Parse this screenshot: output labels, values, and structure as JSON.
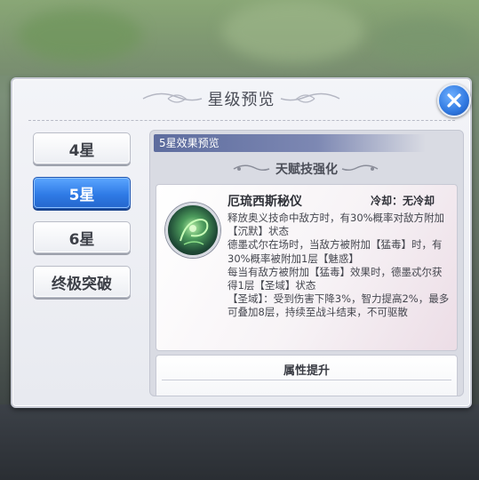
{
  "dialog": {
    "title": "星级预览"
  },
  "star_tabs": [
    {
      "label": "4星",
      "active": false
    },
    {
      "label": "5星",
      "active": true
    },
    {
      "label": "6星",
      "active": false
    },
    {
      "label": "终极突破",
      "active": false
    }
  ],
  "preview": {
    "header": "5星效果预览",
    "section_title": "天赋技强化",
    "skill": {
      "name": "厄琉西斯秘仪",
      "cooldown": "冷却：无冷却",
      "description": "释放奥义技命中敌方时，有30%概率对敌方附加【沉默】状态\n德墨忒尔在场时，当敌方被附加【猛毒】时，有30%概率被附加1层【魅惑】\n每当有敌方被附加【猛毒】效果时，德墨忒尔获得1层【圣域】状态\n【圣域】：受到伤害下降3%，智力提高2%，最多可叠加8层，持续至战斗结束，不可驱散"
    },
    "attribute_title": "属性提升"
  },
  "colors": {
    "active_tab": "#2f7be6",
    "header_bar": "#5d6c9e",
    "close_button": "#2f78e0"
  }
}
